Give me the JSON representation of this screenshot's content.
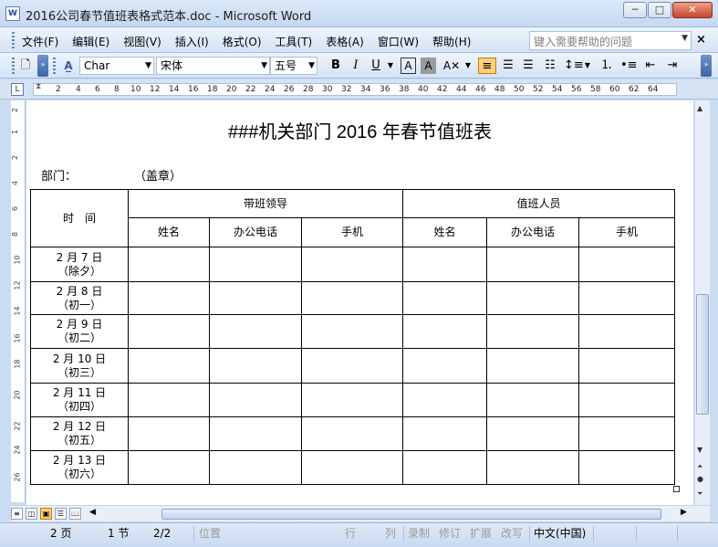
{
  "window": {
    "title": "2016公司春节值班表格式范本.doc - Microsoft Word",
    "app_icon": "W",
    "buttons": {
      "minimize": "─",
      "maximize": "□",
      "close": "✕"
    }
  },
  "menubar": {
    "items": [
      "文件(F)",
      "编辑(E)",
      "视图(V)",
      "插入(I)",
      "格式(O)",
      "工具(T)",
      "表格(A)",
      "窗口(W)",
      "帮助(H)"
    ],
    "help_placeholder": "键入需要帮助的问题",
    "close_glyph": "×"
  },
  "toolbar": {
    "style_value": "Char",
    "font_value": "宋体",
    "size_value": "五号",
    "bold": "B",
    "italic": "I",
    "underline": "U"
  },
  "ruler": {
    "marks": [
      "2",
      "4",
      "6",
      "8",
      "10",
      "12",
      "14",
      "16",
      "18",
      "20",
      "22",
      "24",
      "26",
      "28",
      "30",
      "32",
      "34",
      "36",
      "38",
      "40",
      "42",
      "44",
      "46",
      "48",
      "50",
      "52",
      "54",
      "56",
      "58",
      "60",
      "62",
      "64"
    ],
    "vertical_marks": [
      "2",
      "1",
      "2",
      "4",
      "6",
      "8",
      "10",
      "12",
      "14",
      "16",
      "18",
      "20",
      "22",
      "24",
      "26"
    ],
    "corner_glyph": "L"
  },
  "document": {
    "title": "###机关部门 2016 年春节值班表",
    "dept_label": "部门：",
    "stamp_label": "（盖章）",
    "table": {
      "time_header": "时　间",
      "leader_header": "带班领导",
      "staff_header": "值班人员",
      "sub_headers": [
        "姓名",
        "办公电话",
        "手机",
        "姓名",
        "办公电话",
        "手机"
      ],
      "rows": [
        {
          "date": "2 月 7 日",
          "day": "（除夕）"
        },
        {
          "date": "2 月 8 日",
          "day": "（初一）"
        },
        {
          "date": "2 月 9 日",
          "day": "（初二）"
        },
        {
          "date": "2 月 10 日",
          "day": "（初三）"
        },
        {
          "date": "2 月 11 日",
          "day": "（初四）"
        },
        {
          "date": "2 月 12 日",
          "day": "（初五）"
        },
        {
          "date": "2 月 13 日",
          "day": "（初六）"
        }
      ]
    }
  },
  "statusbar": {
    "page": "2 页",
    "section": "1 节",
    "page_of": "2/2",
    "position": "位置",
    "line": "行",
    "column": "列",
    "rec": "录制",
    "trk": "修订",
    "ext": "扩展",
    "ovr": "改写",
    "language": "中文(中国)"
  },
  "colors": {
    "titlebar": "#c5d8f1",
    "toolbar": "#d4e3f6",
    "close_button": "#c9452c",
    "active_view": "#ffcf7a"
  }
}
